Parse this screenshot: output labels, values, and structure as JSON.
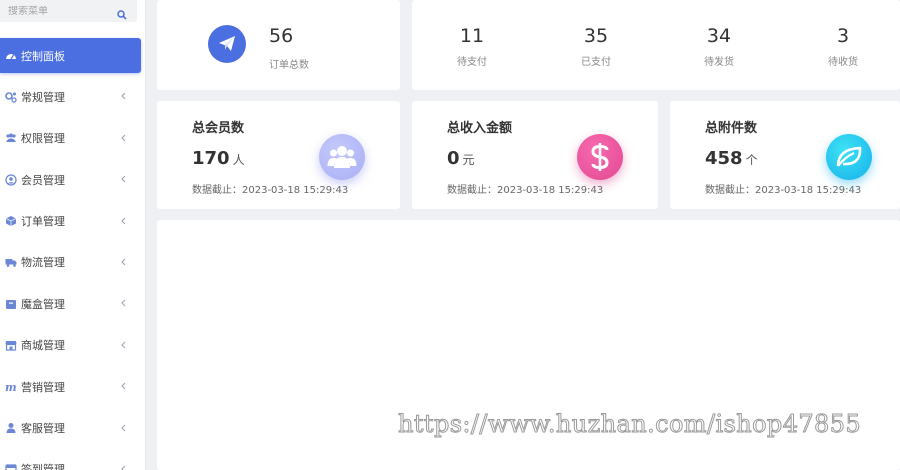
{
  "sidebar": {
    "search_placeholder": "搜索菜单",
    "items": [
      {
        "label": "控制面板",
        "icon": "dashboard-icon",
        "active": true
      },
      {
        "label": "常规管理",
        "icon": "cogs-icon"
      },
      {
        "label": "权限管理",
        "icon": "users-group-icon"
      },
      {
        "label": "会员管理",
        "icon": "user-circle-icon"
      },
      {
        "label": "订单管理",
        "icon": "cube-icon"
      },
      {
        "label": "物流管理",
        "icon": "truck-icon"
      },
      {
        "label": "魔盒管理",
        "icon": "box-icon"
      },
      {
        "label": "商城管理",
        "icon": "shop-icon"
      },
      {
        "label": "营销管理",
        "icon": "marketing-m-icon"
      },
      {
        "label": "客服管理",
        "icon": "user-icon"
      },
      {
        "label": "签到管理",
        "icon": "calendar-icon"
      }
    ]
  },
  "orders": {
    "count": "56",
    "label": "订单总数",
    "icon": "paper-plane-icon"
  },
  "order_status": [
    {
      "count": "11",
      "label": "待支付"
    },
    {
      "count": "35",
      "label": "已支付"
    },
    {
      "count": "34",
      "label": "待发货"
    },
    {
      "count": "3",
      "label": "待收货"
    }
  ],
  "stats": {
    "members": {
      "title": "总会员数",
      "value": "170",
      "unit": "人",
      "date": "数据截止：2023-03-18 15:29:43",
      "icon": "users-icon",
      "color": "#a9aef5"
    },
    "income": {
      "title": "总收入金额",
      "value": "0",
      "unit": "元",
      "date": "数据截止：2023-03-18 15:29:43",
      "icon": "dollar-icon",
      "color": "#e44892"
    },
    "attachments": {
      "title": "总附件数",
      "value": "458",
      "unit": "个",
      "date": "数据截止：2023-03-18 15:29:43",
      "icon": "leaf-icon",
      "color": "#17b0ea"
    }
  },
  "colors": {
    "accent": "#4b6ee0",
    "background": "#eef0f4"
  },
  "watermark": "https://www.huzhan.com/ishop47855"
}
